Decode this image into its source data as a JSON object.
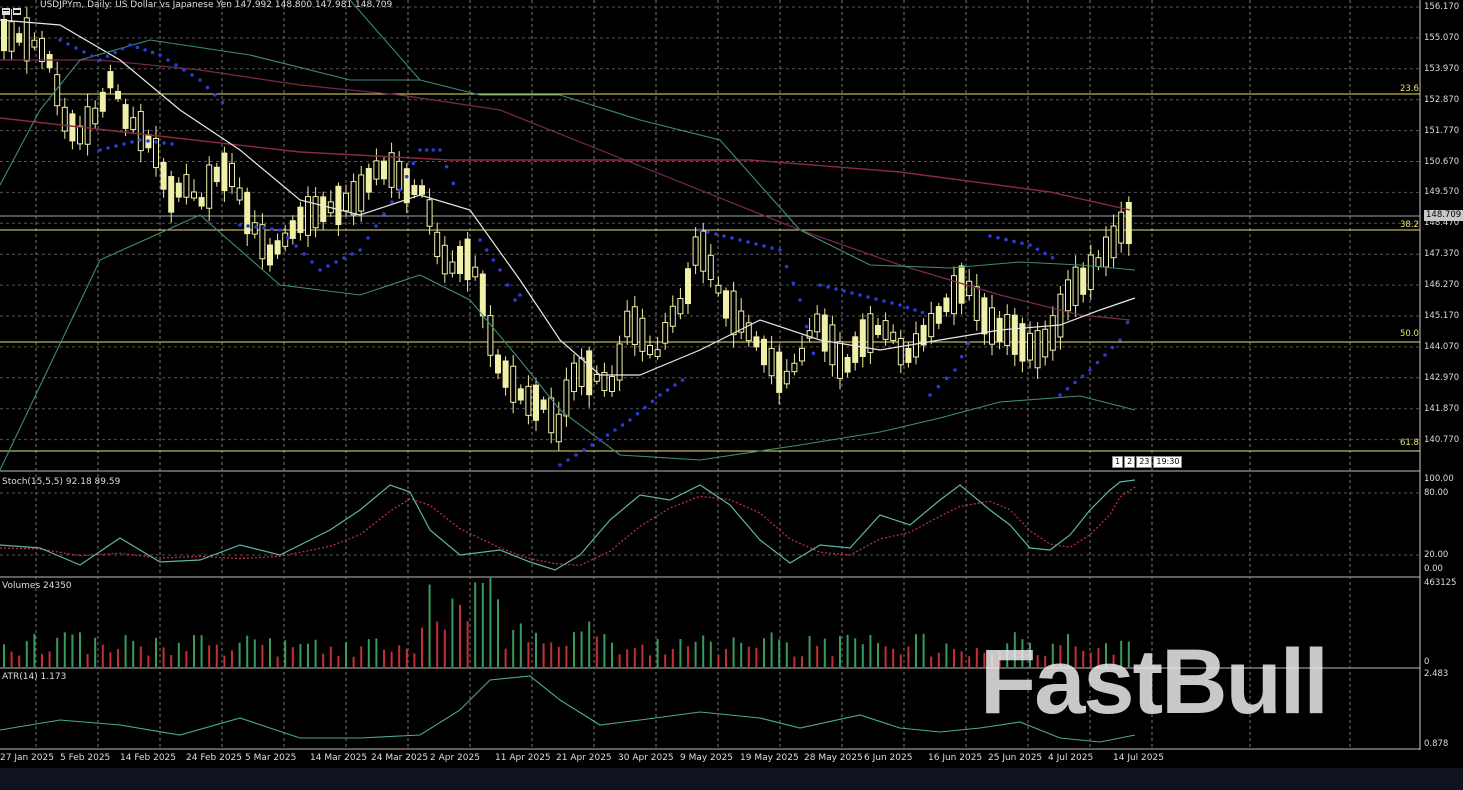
{
  "header": {
    "title": "USDJPYm, Daily:  US Dollar vs Japanese Yen  147.992 148.800 147.981 148.709"
  },
  "price_axis": [
    "156.170",
    "155.070",
    "153.970",
    "152.870",
    "151.770",
    "150.670",
    "149.570",
    "148.470",
    "147.370",
    "146.270",
    "145.170",
    "144.070",
    "142.970",
    "141.870",
    "140.770"
  ],
  "current_price": "148.709",
  "fibo_levels": {
    "f236": "23.6",
    "f382": "38.2",
    "f500": "50.0",
    "f618": "61.8"
  },
  "time_box": [
    "1",
    "2",
    "23",
    "19:30"
  ],
  "stoch": {
    "label": "Stoch(15,5,5) 92.18 89.59",
    "levels": [
      "100.00",
      "80.00",
      "20.00",
      "0.00"
    ]
  },
  "volumes": {
    "label": "Volumes 24350",
    "levels": [
      "463125",
      "0"
    ]
  },
  "atr": {
    "label": "ATR(14) 1.173",
    "levels": [
      "2.483",
      "0.878"
    ]
  },
  "dates": [
    "27 Jan 2025",
    "5 Feb 2025",
    "14 Feb 2025",
    "24 Feb 2025",
    "5 Mar 2025",
    "14 Mar 2025",
    "24 Mar 2025",
    "2 Apr 2025",
    "11 Apr 2025",
    "21 Apr 2025",
    "30 Apr 2025",
    "9 May 2025",
    "19 May 2025",
    "28 May 2025",
    "6 Jun 2025",
    "16 Jun 2025",
    "25 Jun 2025",
    "4 Jul 2025",
    "14 Jul 2025"
  ],
  "watermark": "FastBull",
  "colors": {
    "bull": "#f0f0a8",
    "bear": "#f0f0a8",
    "sar": "#2a3cd8",
    "ma_slow": "#8b2b3b",
    "ma_fast": "#e8e8e8",
    "band": "#3f8a76",
    "fibo": "#e8e070",
    "stoch_main": "#5fb3a6",
    "stoch_signal": "#c4343f",
    "vol_up": "#3a9a5a",
    "vol_down": "#c43030",
    "atr": "#4aa89a"
  }
}
